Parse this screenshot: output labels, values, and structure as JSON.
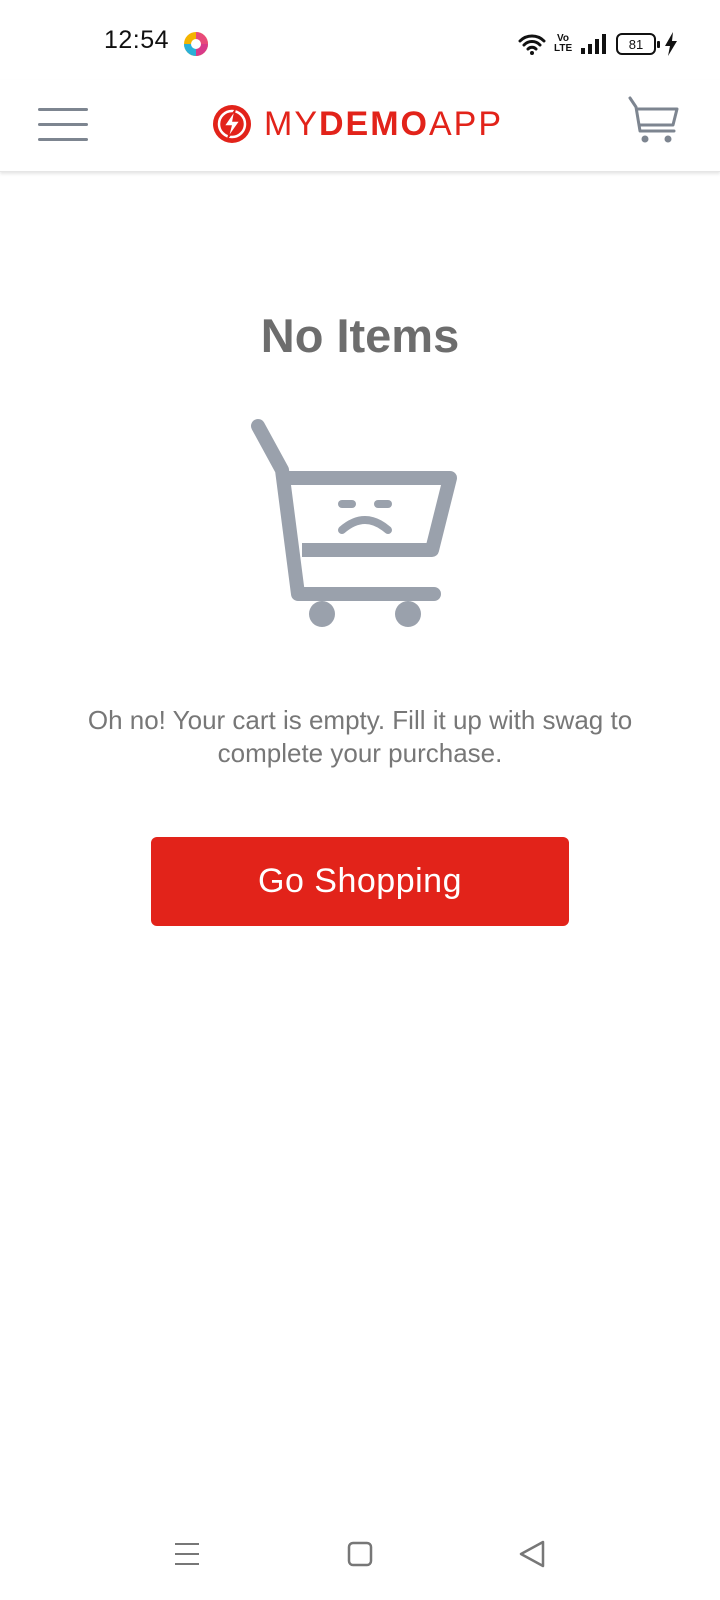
{
  "status_bar": {
    "time": "12:54",
    "battery_level": "81",
    "icons": [
      "app-notification-icon",
      "wifi-icon",
      "volte-icon",
      "signal-icon",
      "battery-icon",
      "charging-icon"
    ],
    "volte_top": "Vo",
    "volte_bottom": "LTE"
  },
  "header": {
    "brand_my": "MY",
    "brand_demo": "DEMO",
    "brand_app": "APP",
    "menu_icon": "hamburger-menu-icon",
    "cart_icon": "shopping-cart-icon"
  },
  "main": {
    "title": "No Items",
    "illustration_icon": "sad-cart-icon",
    "message": "Oh no! Your cart is empty. Fill it up with swag to complete your purchase.",
    "button_label": "Go Shopping"
  },
  "nav_bar": {
    "icons": [
      "recents-icon",
      "home-icon",
      "back-icon"
    ]
  },
  "colors": {
    "brand_red": "#e2231a",
    "icon_gray": "#9aa1ac",
    "title_gray": "#6d6d6d",
    "text_gray": "#777777"
  }
}
